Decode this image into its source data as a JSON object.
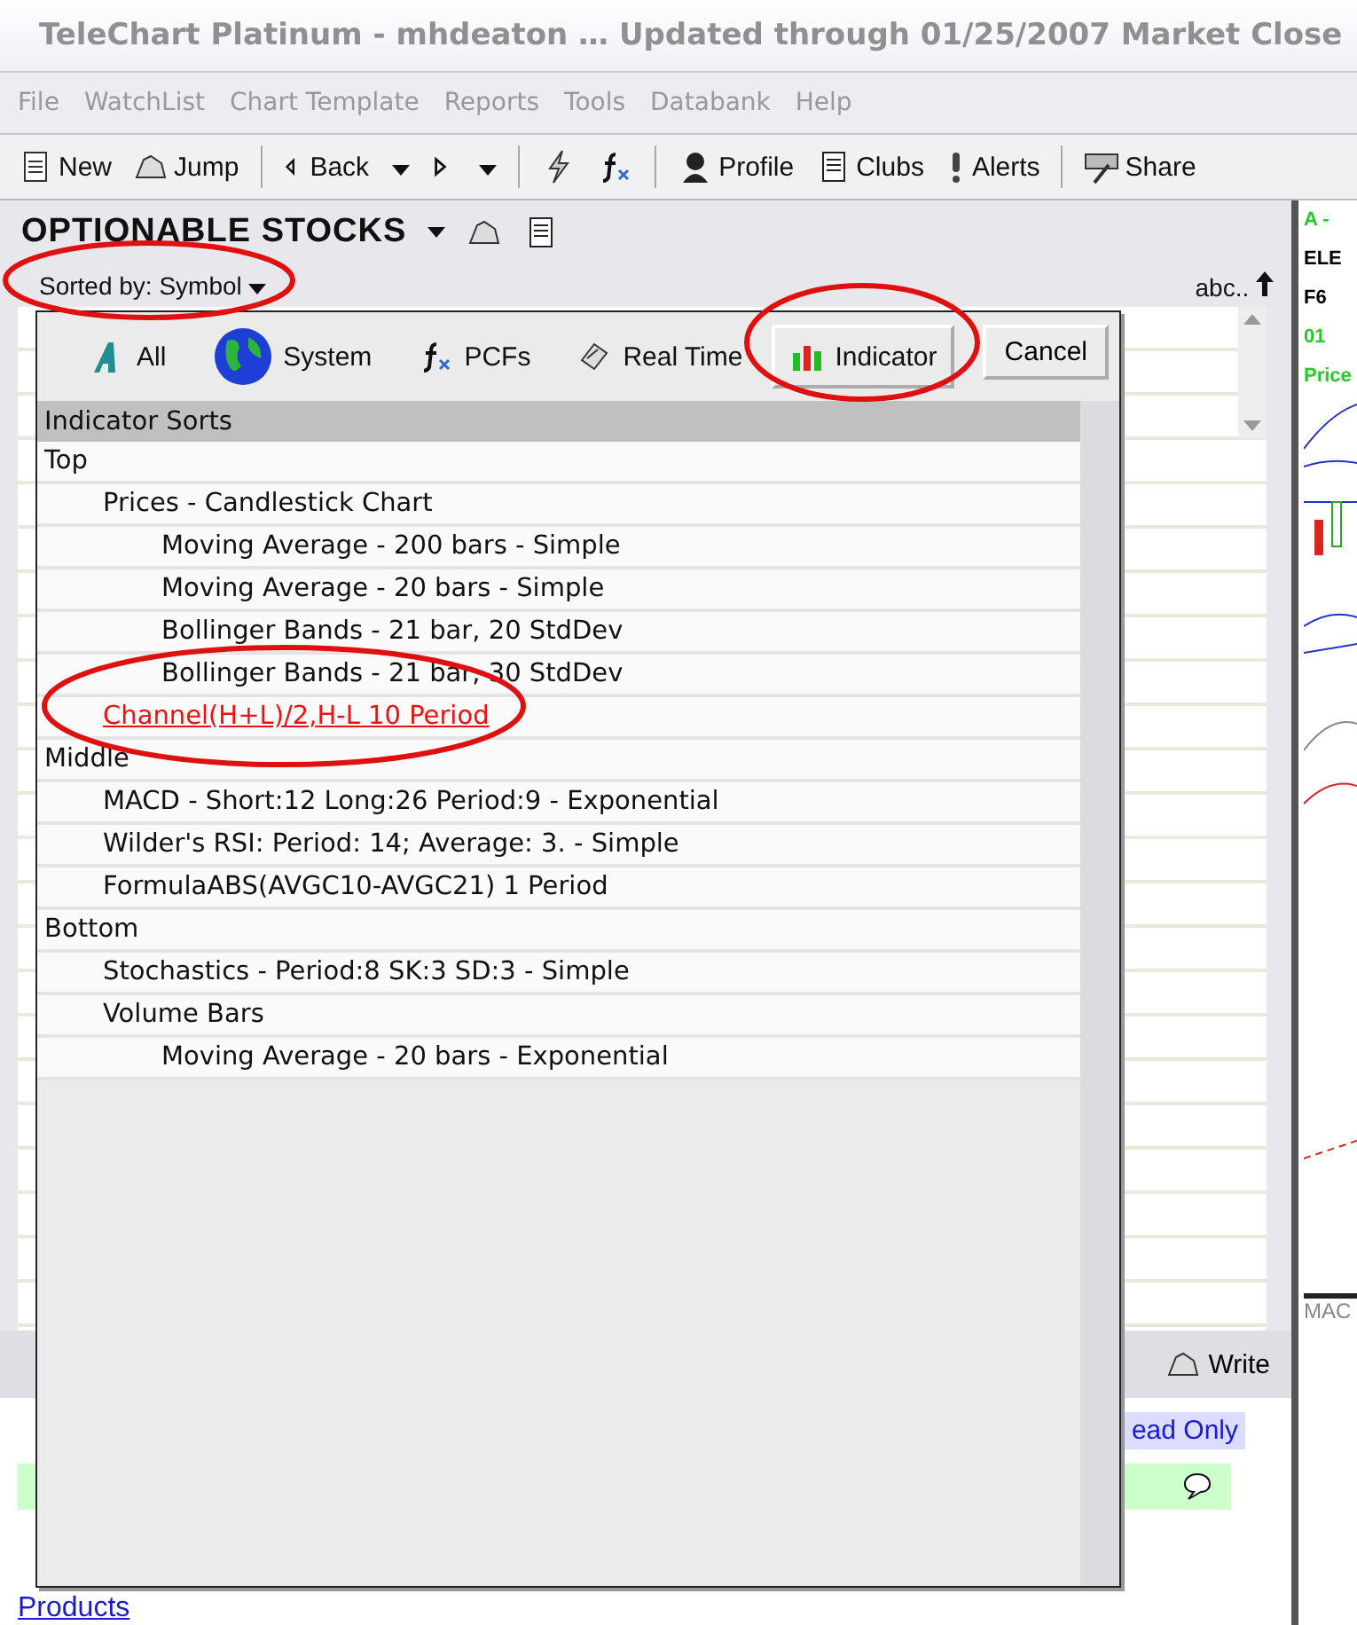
{
  "window": {
    "title": "TeleChart Platinum - mhdeaton  … Updated through 01/25/2007  Market Close"
  },
  "menu": [
    "File",
    "WatchList",
    "Chart Template",
    "Reports",
    "Tools",
    "Databank",
    "Help"
  ],
  "toolbar": [
    {
      "kind": "button",
      "label": "New"
    },
    {
      "kind": "button",
      "label": "Jump"
    },
    {
      "kind": "separator"
    },
    {
      "kind": "button",
      "label": "Back"
    },
    {
      "kind": "icon"
    },
    {
      "kind": "separator"
    },
    {
      "kind": "icon"
    },
    {
      "kind": "icon"
    },
    {
      "kind": "separator"
    },
    {
      "kind": "button",
      "label": "Profile"
    },
    {
      "kind": "button",
      "label": "Clubs"
    },
    {
      "kind": "button",
      "label": "Alerts"
    },
    {
      "kind": "separator"
    },
    {
      "kind": "button",
      "label": "Share"
    }
  ],
  "watchlist": {
    "title": "OPTIONABLE STOCKS",
    "sort_label": "Sorted by: Symbol",
    "sort_order": "abc.."
  },
  "popup": {
    "tabs": [
      {
        "label": "All",
        "selected": false
      },
      {
        "label": "System",
        "selected": false
      },
      {
        "label": "PCFs",
        "selected": false
      },
      {
        "label": "Real Time",
        "selected": false
      },
      {
        "label": "Indicator",
        "selected": true
      }
    ],
    "cancel": "Cancel",
    "header": "Indicator Sorts",
    "tree": [
      {
        "label": "Top",
        "selected": false,
        "children": [
          {
            "label": "Prices - Candlestick Chart",
            "selected": false,
            "children": [
              {
                "label": "Moving Average - 200 bars - Simple",
                "selected": false
              },
              {
                "label": "Moving Average - 20 bars - Simple",
                "selected": false
              },
              {
                "label": "Bollinger Bands - 21 bar, 20 StdDev",
                "selected": false
              },
              {
                "label": "Bollinger Bands - 21 bar, 30 StdDev",
                "selected": false
              }
            ]
          },
          {
            "label": "Channel(H+L)/2,H-L 10 Period",
            "selected": true
          }
        ]
      },
      {
        "label": "Middle",
        "selected": false,
        "children": [
          {
            "label": "MACD -  Short:12 Long:26 Period:9 - Exponential",
            "selected": false
          },
          {
            "label": "Wilder's RSI: Period: 14; Average: 3. - Simple",
            "selected": false
          },
          {
            "label": "FormulaABS(AVGC10-AVGC21) 1 Period",
            "selected": false
          }
        ]
      },
      {
        "label": "Bottom",
        "selected": false,
        "children": [
          {
            "label": "Stochastics -  Period:8 SK:3 SD:3 - Simple",
            "selected": false
          },
          {
            "label": "Volume Bars",
            "selected": false,
            "children": [
              {
                "label": "Moving Average - 20 bars - Exponential",
                "selected": false
              }
            ]
          }
        ]
      }
    ]
  },
  "notes": {
    "write": "Write",
    "read_only": "ead Only",
    "link": "Products"
  },
  "chart_strip": {
    "texts": [
      {
        "text": "A -",
        "color": "#22cc22"
      },
      {
        "text": "ELE",
        "color": "#000000"
      },
      {
        "text": "F6",
        "color": "#000000"
      },
      {
        "text": "01",
        "color": "#22cc22"
      },
      {
        "text": "Price",
        "color": "#22cc22"
      }
    ],
    "lower_label": "MAC"
  }
}
